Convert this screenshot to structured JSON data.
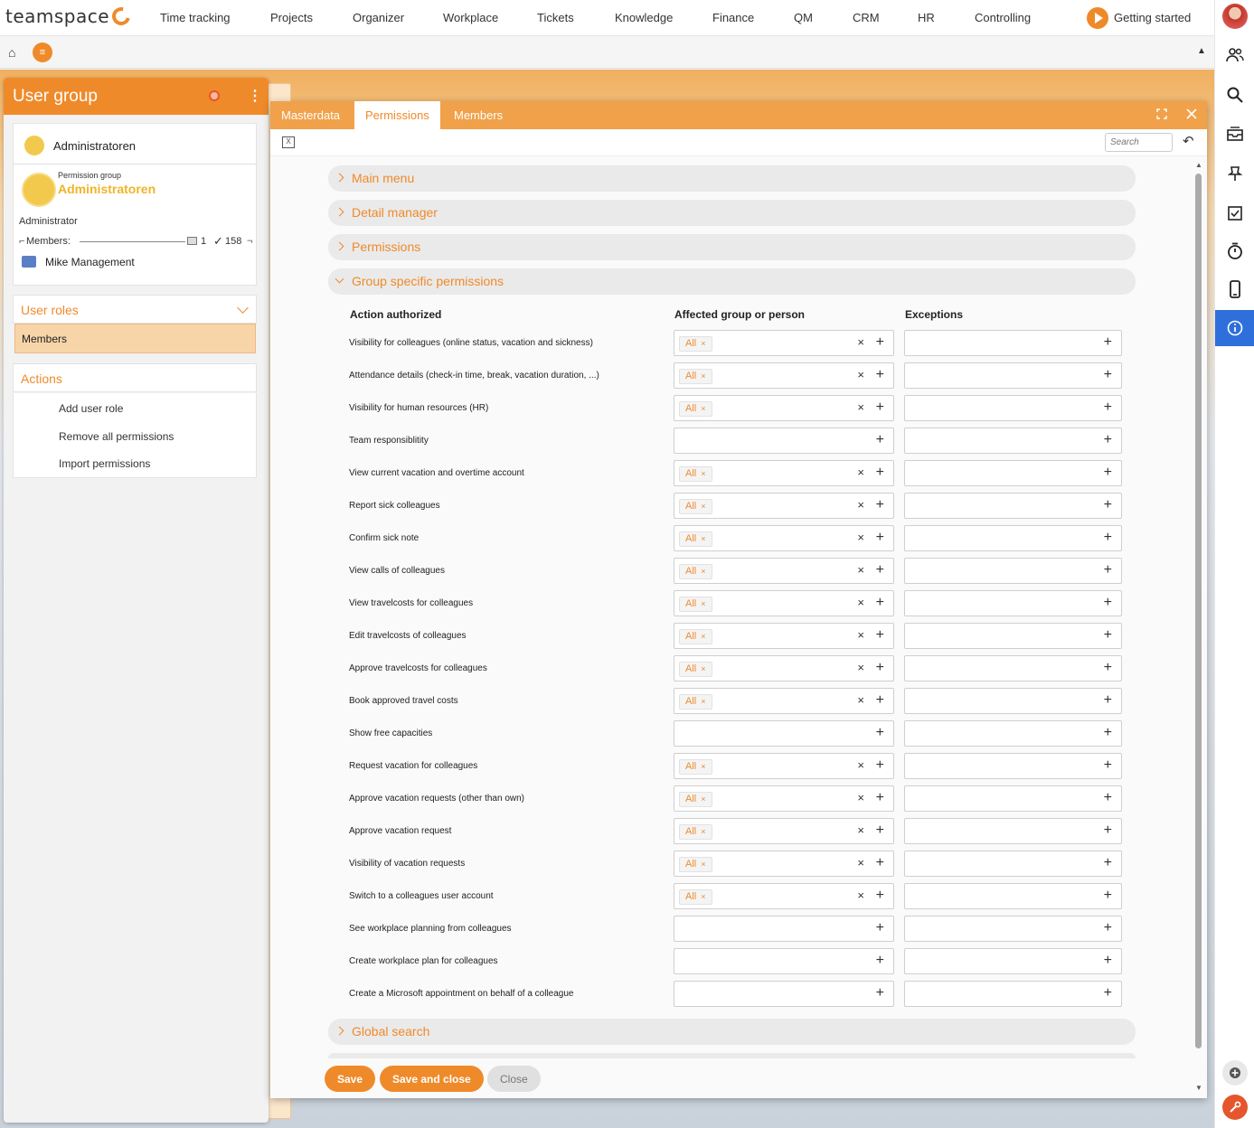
{
  "app": {
    "logo": "teamspace",
    "nav": [
      "Time tracking",
      "Projects",
      "Organizer",
      "Workplace",
      "Tickets",
      "Knowledge",
      "Finance",
      "QM",
      "CRM",
      "HR",
      "Controlling"
    ],
    "getting_started": "Getting started"
  },
  "icons": {
    "home": "⌂",
    "menu": "≡",
    "collapse": "▲",
    "right_sidebar": [
      "people-icon",
      "search-icon",
      "inbox-icon",
      "pin-icon",
      "checklist-icon",
      "stopwatch-icon",
      "phone-icon",
      "info-icon"
    ],
    "add": "+",
    "clear": "×",
    "chip_remove": "×",
    "maximize": "⛶",
    "close": "✕",
    "undo": "↶",
    "check": "✓"
  },
  "left_panel": {
    "title": "User group",
    "group_name": "Administratoren",
    "permission_group_label": "Permission group",
    "permission_group_name": "Administratoren",
    "role": "Administrator",
    "members_label": "Members:",
    "members_count_1": "1",
    "members_count_2": "158",
    "member_name": "Mike Management",
    "user_roles_header": "User roles",
    "members_item": "Members",
    "actions_header": "Actions",
    "actions": [
      "Add user role",
      "Remove all permissions",
      "Import permissions"
    ]
  },
  "dialog": {
    "tabs": [
      "Masterdata",
      "Permissions",
      "Members"
    ],
    "active_tab": "Permissions",
    "search_placeholder": "Search",
    "sections": {
      "main_menu": "Main menu",
      "detail_manager": "Detail manager",
      "permissions": "Permissions",
      "group_specific": "Group specific permissions",
      "global_search": "Global search"
    },
    "columns": {
      "action": "Action authorized",
      "affected": "Affected group or person",
      "exceptions": "Exceptions"
    },
    "rows": [
      {
        "label": "Visibility for colleagues (online status, vacation and sickness)",
        "affected": "All"
      },
      {
        "label": "Attendance details (check-in time, break, vacation duration, ...)",
        "affected": "All"
      },
      {
        "label": "Visibility for human resources (HR)",
        "affected": "All"
      },
      {
        "label": "Team responsiblitity",
        "affected": ""
      },
      {
        "label": "View current vacation and overtime account",
        "affected": "All"
      },
      {
        "label": "Report sick colleagues",
        "affected": "All"
      },
      {
        "label": "Confirm sick note",
        "affected": "All"
      },
      {
        "label": "View calls of colleagues",
        "affected": "All"
      },
      {
        "label": "View travelcosts for colleagues",
        "affected": "All"
      },
      {
        "label": "Edit travelcosts of colleagues",
        "affected": "All"
      },
      {
        "label": "Approve travelcosts for colleagues",
        "affected": "All"
      },
      {
        "label": "Book approved travel costs",
        "affected": "All"
      },
      {
        "label": "Show free capacities",
        "affected": ""
      },
      {
        "label": "Request vacation for colleagues",
        "affected": "All"
      },
      {
        "label": "Approve vacation requests (other than own)",
        "affected": "All"
      },
      {
        "label": "Approve vacation request",
        "affected": "All"
      },
      {
        "label": "Visibility of vacation requests",
        "affected": "All"
      },
      {
        "label": "Switch to a colleagues user account",
        "affected": "All"
      },
      {
        "label": "See workplace planning from colleagues",
        "affected": ""
      },
      {
        "label": "Create workplace plan for colleagues",
        "affected": ""
      },
      {
        "label": "Create a Microsoft appointment on behalf of a colleague",
        "affected": ""
      }
    ],
    "buttons": {
      "save": "Save",
      "save_close": "Save and close",
      "close": "Close"
    }
  },
  "colors": {
    "accent": "#ef8a2a",
    "tab_bar": "#f0a14a",
    "info_active": "#2f6fdb"
  }
}
